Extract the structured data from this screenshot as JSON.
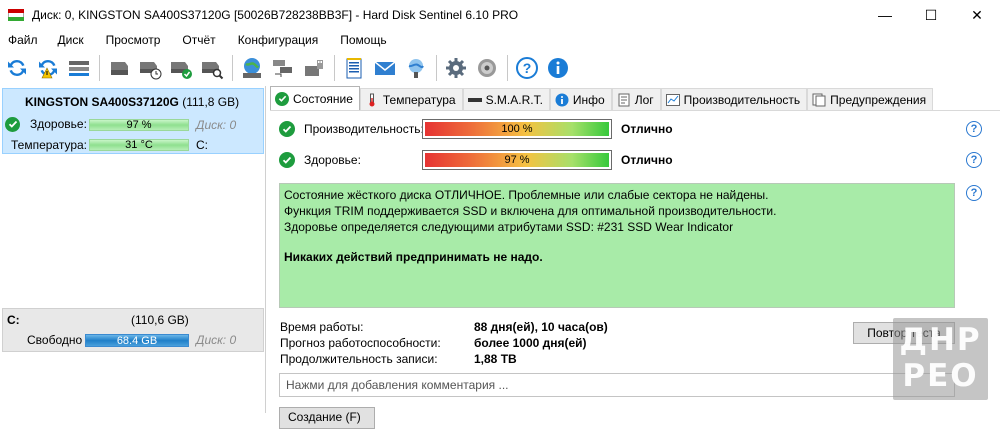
{
  "window": {
    "title": "Диск: 0, KINGSTON SA400S37120G [50026B728238BB3F]  -  Hard Disk Sentinel 6.10 PRO",
    "min_glyph": "—",
    "max_glyph": "☐",
    "close_glyph": "✕"
  },
  "menu": [
    "Файл",
    "Диск",
    "Просмотр",
    "Отчёт",
    "Конфигурация",
    "Помощь"
  ],
  "toolbar": {
    "icons": [
      "refresh-icon",
      "refresh-warning-icon",
      "disk-list-icon",
      "hdd-icon",
      "hdd-timer-icon",
      "hdd-check-icon",
      "hdd-search-icon",
      "globe-drive-icon",
      "network-drives-icon",
      "usb-drive-icon",
      "report-icon",
      "email-icon",
      "send-report-icon",
      "settings-icon",
      "sound-icon",
      "help-icon",
      "info-icon"
    ]
  },
  "left": {
    "disk": {
      "model": "KINGSTON SA400S37120G",
      "size": "(111,8 GB)",
      "health_label": "Здоровье:",
      "health_value": "97 %",
      "disk_label": "Диск: 0",
      "temp_label": "Температура:",
      "temp_value": "31 °C",
      "drive_letter": "C:",
      "health_percent": 97
    },
    "partition": {
      "letter": "C:",
      "size": "(110,6 GB)",
      "free_label": "Свободно",
      "free_value": "68.4 GB",
      "disk_label": "Диск: 0",
      "free_fraction": 0.62
    }
  },
  "tabs": [
    {
      "label": "Состояние",
      "icon": "check-circle-icon",
      "active": true
    },
    {
      "label": "Температура",
      "icon": "thermometer-icon",
      "active": false
    },
    {
      "label": "S.M.A.R.T.",
      "icon": "smart-bar-icon",
      "active": false
    },
    {
      "label": "Инфо",
      "icon": "info-icon",
      "active": false
    },
    {
      "label": "Лог",
      "icon": "log-icon",
      "active": false
    },
    {
      "label": "Производительность",
      "icon": "chart-icon",
      "active": false
    },
    {
      "label": "Предупреждения",
      "icon": "alerts-icon",
      "active": false
    }
  ],
  "status": {
    "performance_label": "Производительность:",
    "performance_value": "100 %",
    "performance_rating": "Отлично",
    "health_label": "Здоровье:",
    "health_value": "97 %",
    "health_rating": "Отлично",
    "description_lines": [
      "Состояние жёсткого диска ОТЛИЧНОЕ. Проблемные или слабые сектора не найдены.",
      "Функция TRIM поддерживается SSD и включена для оптимальной производительности.",
      "Здоровье определяется следующими атрибутами SSD: #231 SSD Wear Indicator"
    ],
    "action_text": "Никаких действий предпринимать не надо.",
    "uptime_label": "Время работы:",
    "uptime_value": "88 дня(ей), 10 часа(ов)",
    "forecast_label": "Прогноз работоспособности:",
    "forecast_value": "более 1000 дня(ей)",
    "written_label": "Продолжительность записи:",
    "written_value": "1,88 TB",
    "test_button": "Повтор теста",
    "comment_placeholder": "Нажми для добавления комментария ...",
    "bottom_button": "Создание (F)"
  },
  "watermark": {
    "line1": "ДНР",
    "line2": "РЕО"
  },
  "colors": {
    "selection": "#cce8ff",
    "ok_green": "#1e9c3e",
    "description_bg": "#a8eba8",
    "free_bar": "#1f7fc8"
  }
}
